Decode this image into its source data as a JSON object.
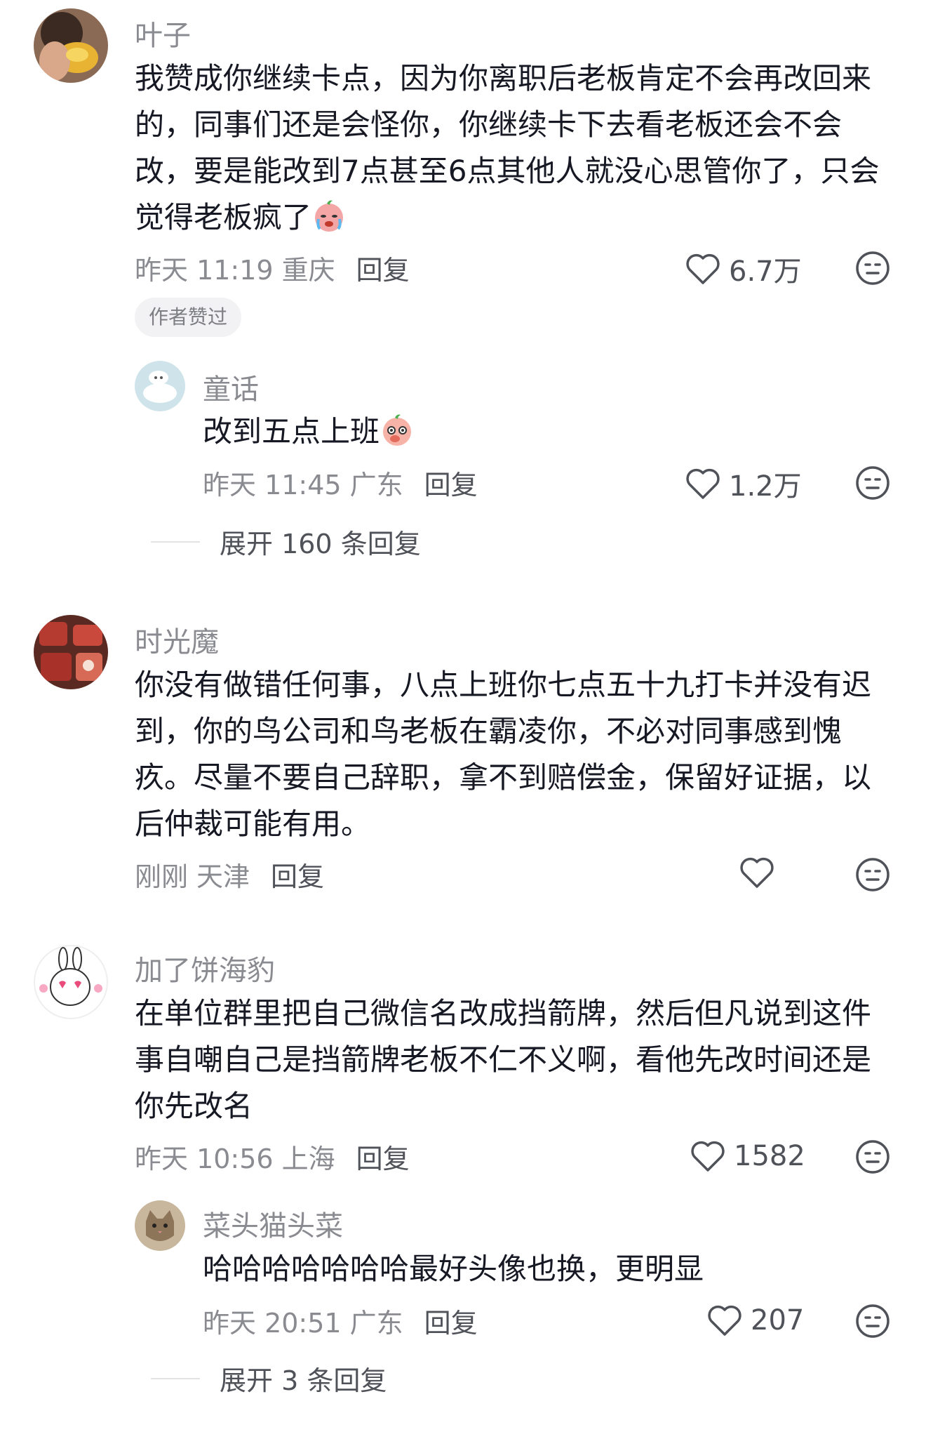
{
  "comments": [
    {
      "username": "叶子",
      "lines": [
        "我赞成你继续卡点，因为你离职后老板肯定不会再改回来",
        "的，同事们还是会怪你，你继续卡下去看老板还会不会",
        "改，要是能改到7点甚至6点其他人就没心思管你了，只会",
        "觉得老板疯了"
      ],
      "time": "昨天 11:19",
      "location": "重庆",
      "reply_label": "回复",
      "likes": "6.7万",
      "badge": "作者赞过",
      "replies": [
        {
          "username": "童话",
          "text": "改到五点上班",
          "time": "昨天 11:45",
          "location": "广东",
          "reply_label": "回复",
          "likes": "1.2万"
        }
      ],
      "expand_label": "展开 160 条回复"
    },
    {
      "username": "时光魔",
      "lines": [
        "你没有做错任何事，八点上班你七点五十九打卡并没有迟",
        "到，你的鸟公司和鸟老板在霸凌你，不必对同事感到愧",
        "疚。尽量不要自己辞职，拿不到赔偿金，保留好证据，以",
        "后仲裁可能有用。"
      ],
      "time": "刚刚",
      "location": "天津",
      "reply_label": "回复",
      "likes": ""
    },
    {
      "username": "加了饼海豹",
      "lines": [
        "在单位群里把自己微信名改成挡箭牌，然后但凡说到这件",
        "事自嘲自己是挡箭牌老板不仁不义啊，看他先改时间还是",
        "你先改名"
      ],
      "time": "昨天 10:56",
      "location": "上海",
      "reply_label": "回复",
      "likes": "1582",
      "replies": [
        {
          "username": "菜头猫头菜",
          "text": "哈哈哈哈哈哈哈最好头像也换，更明显",
          "time": "昨天 20:51",
          "location": "广东",
          "reply_label": "回复",
          "likes": "207"
        }
      ],
      "expand_label": "展开 3 条回复"
    }
  ]
}
